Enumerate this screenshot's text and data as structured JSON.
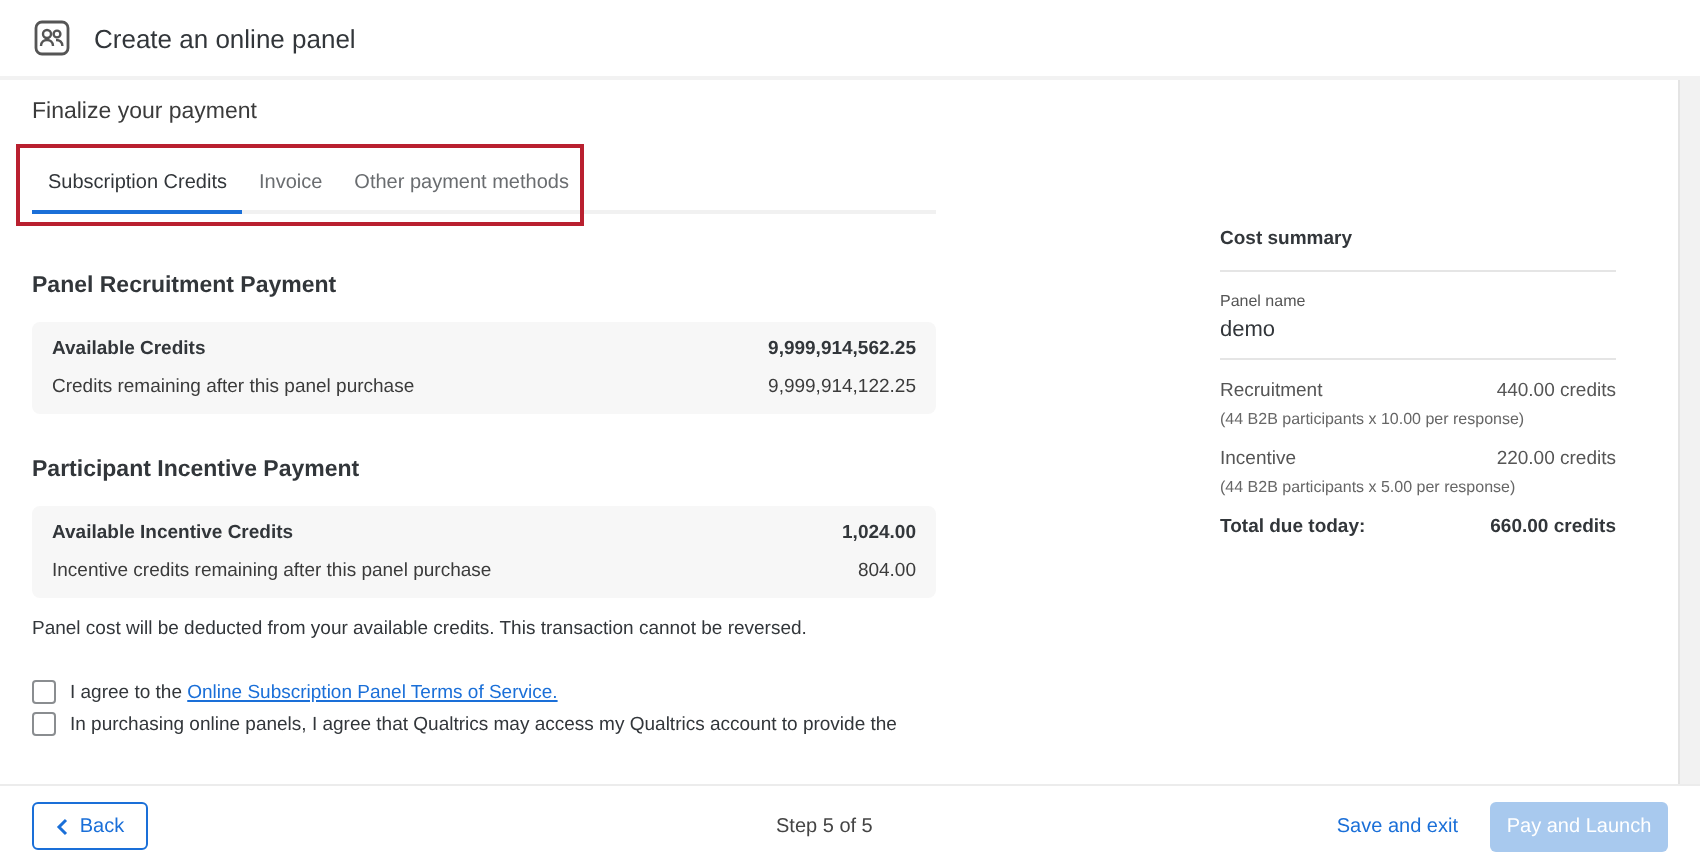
{
  "header": {
    "title": "Create an online panel"
  },
  "page_title": "Finalize your payment",
  "tabs": [
    {
      "label": "Subscription Credits",
      "selected": true
    },
    {
      "label": "Invoice",
      "selected": false
    },
    {
      "label": "Other payment methods",
      "selected": false
    }
  ],
  "sections": [
    {
      "heading": "Panel Recruitment Payment",
      "rows": [
        {
          "label": "Available Credits",
          "value": "9,999,914,562.25",
          "bold": true
        },
        {
          "label": "Credits remaining after this panel purchase",
          "value": "9,999,914,122.25",
          "bold": false
        }
      ]
    },
    {
      "heading": "Participant Incentive Payment",
      "rows": [
        {
          "label": "Available Incentive Credits",
          "value": "1,024.00",
          "bold": true
        },
        {
          "label": "Incentive credits remaining after this panel purchase",
          "value": "804.00",
          "bold": false
        }
      ]
    }
  ],
  "note": "Panel cost will be deducted from your available credits. This transaction cannot be reversed.",
  "agreements": [
    {
      "text": "I agree to the ",
      "link": "Online Subscription Panel Terms of Service.",
      "checked": false
    },
    {
      "text": "In purchasing online panels, I agree that Qualtrics may access my Qualtrics account to provide the",
      "checked": false
    }
  ],
  "summary": {
    "title": "Cost summary",
    "panel_name_label": "Panel name",
    "panel_name": "demo",
    "lines": [
      {
        "label": "Recruitment",
        "amount": "440.00 credits",
        "detail": "(44 B2B participants x 10.00 per response)"
      },
      {
        "label": "Incentive",
        "amount": "220.00 credits",
        "detail": "(44 B2B participants x 5.00 per response)"
      }
    ],
    "total_label": "Total due today:",
    "total": "660.00 credits"
  },
  "footer": {
    "back": "Back",
    "step": "Step 5 of 5",
    "save": "Save and exit",
    "pay": {
      "label": "Pay and Launch",
      "disabled": true
    }
  }
}
